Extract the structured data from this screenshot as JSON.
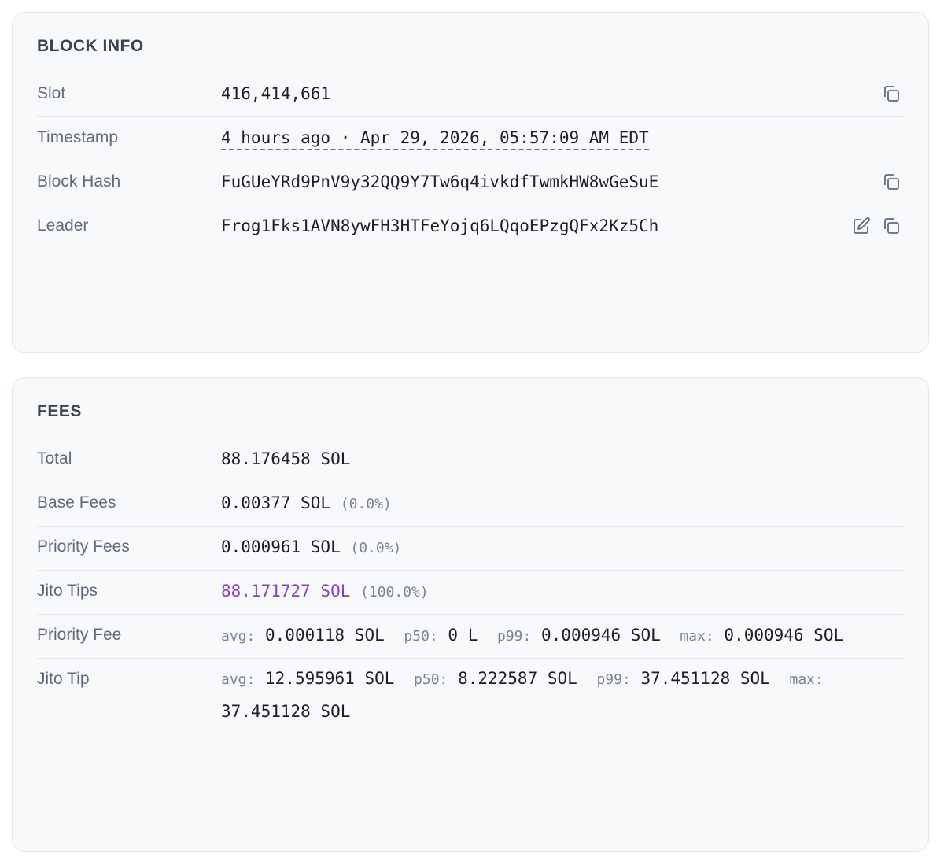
{
  "block_info": {
    "title": "BLOCK INFO",
    "slot": {
      "label": "Slot",
      "value": "416,414,661"
    },
    "timestamp": {
      "label": "Timestamp",
      "value": "4 hours ago · Apr 29, 2026, 05:57:09 AM EDT"
    },
    "block_hash": {
      "label": "Block Hash",
      "value": "FuGUeYRd9PnV9y32QQ9Y7Tw6q4ivkdfTwmkHW8wGeSuE"
    },
    "leader": {
      "label": "Leader",
      "value": "Frog1Fks1AVN8ywFH3HTFeYojq6LQqoEPzgQFx2Kz5Ch"
    }
  },
  "fees": {
    "title": "FEES",
    "total": {
      "label": "Total",
      "value": "88.176458 SOL"
    },
    "base_fees": {
      "label": "Base Fees",
      "value": "0.00377 SOL",
      "pct": "(0.0%)"
    },
    "priority_fees": {
      "label": "Priority Fees",
      "value": "0.000961 SOL",
      "pct": "(0.0%)"
    },
    "jito_tips": {
      "label": "Jito Tips",
      "value": "88.171727 SOL",
      "pct": "(100.0%)"
    },
    "priority_fee": {
      "label": "Priority Fee",
      "avg_label": "avg:",
      "avg": "0.000118 SOL",
      "p50_label": "p50:",
      "p50": "0 L",
      "p99_label": "p99:",
      "p99": "0.000946 SOL",
      "max_label": "max:",
      "max": "0.000946 SOL"
    },
    "jito_tip": {
      "label": "Jito Tip",
      "avg_label": "avg:",
      "avg": "12.595961 SOL",
      "p50_label": "p50:",
      "p50": "8.222587 SOL",
      "p99_label": "p99:",
      "p99": "37.451128 SOL",
      "max_label": "max:",
      "max": "37.451128 SOL"
    }
  },
  "colors": {
    "jito_accent": "#8a3fd1",
    "card_bg": "#f8f9fb",
    "border": "#e2e5ea"
  },
  "icons": {
    "copy": "copy-icon",
    "edit": "edit-icon"
  }
}
